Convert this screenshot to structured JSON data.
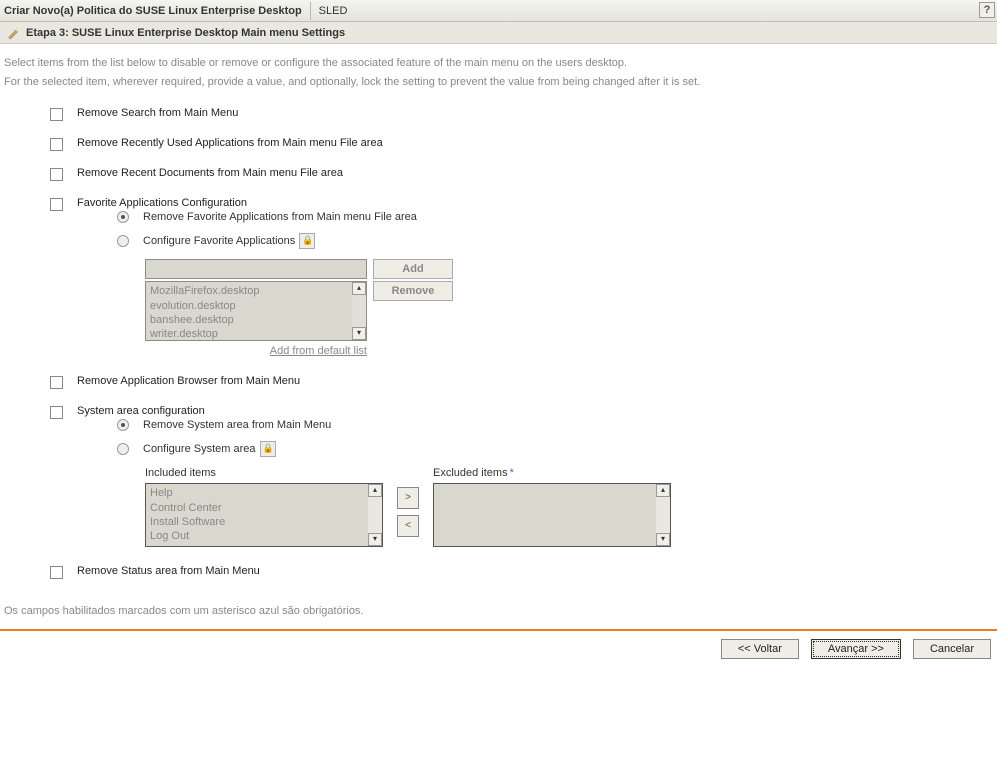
{
  "header": {
    "title": "Criar Novo(a) Politica do SUSE Linux Enterprise Desktop",
    "sub": "SLED",
    "help": "?"
  },
  "step": {
    "label": "Etapa 3: SUSE Linux Enterprise Desktop Main menu Settings"
  },
  "intro": {
    "line1": "Select items from the list below to disable or remove or configure the associated feature of the main menu on the users desktop.",
    "line2": "For the selected item, wherever required, provide a value, and optionally, lock the setting to prevent the value from being changed after it is set."
  },
  "options": {
    "remove_search": "Remove Search from Main Menu",
    "remove_recent_apps": "Remove Recently Used Applications from Main menu File area",
    "remove_recent_docs": "Remove Recent Documents from Main menu File area",
    "fav_config": "Favorite Applications Configuration",
    "fav_opt1": "Remove Favorite Applications from Main menu File area",
    "fav_opt2": "Configure Favorite Applications",
    "add_btn": "Add",
    "remove_btn": "Remove",
    "fav_list": [
      "MozillaFirefox.desktop",
      "evolution.desktop",
      "banshee.desktop",
      "writer.desktop"
    ],
    "add_default": "Add from default list",
    "remove_app_browser": "Remove Application Browser from Main Menu",
    "sys_config": "System area configuration",
    "sys_opt1": "Remove System area from Main Menu",
    "sys_opt2": "Configure System area",
    "included_label": "Included items",
    "excluded_label": "Excluded items",
    "included_list": [
      "Help",
      "Control Center",
      "Install Software",
      "Log Out"
    ],
    "excluded_list": [],
    "remove_status": "Remove Status area from Main Menu"
  },
  "footer": {
    "note": "Os campos habilitados marcados com um asterisco azul são obrigatórios.",
    "back": "<< Voltar",
    "next": "Avançar >>",
    "cancel": "Cancelar"
  }
}
